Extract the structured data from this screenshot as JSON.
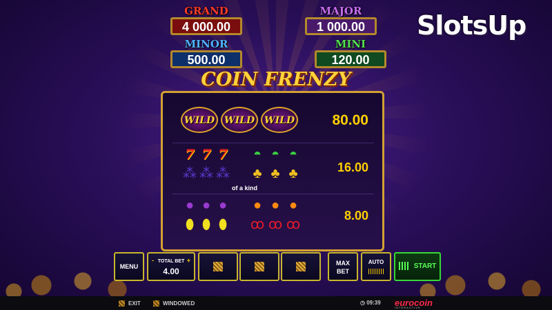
{
  "brand_logo": "SlotsUp",
  "jackpots": {
    "grand": {
      "name": "GRAND",
      "value": "4 000.00"
    },
    "major": {
      "name": "MAJOR",
      "value": "1 000.00"
    },
    "minor": {
      "name": "MINOR",
      "value": "500.00"
    },
    "mini": {
      "name": "MINI",
      "value": "120.00"
    }
  },
  "game_title": "COIN FRENZY",
  "paytable": {
    "rows": [
      {
        "symbols": [
          "WILD",
          "WILD",
          "WILD"
        ],
        "payout": "80.00"
      },
      {
        "symbols": [
          "seven",
          "watermelon",
          "grapes",
          "bell"
        ],
        "payout": "16.00"
      },
      {
        "symbols": [
          "plum",
          "orange",
          "lemon",
          "cherry"
        ],
        "payout": "8.00"
      }
    ],
    "of_a_kind_label": "of a kind"
  },
  "controls": {
    "menu_label": "MENU",
    "total_bet_label": "TOTAL BET",
    "total_bet_value": "4.00",
    "max_bet_label": "MAX BET",
    "auto_label": "AUTO",
    "start_label": "START"
  },
  "bottom_bar": {
    "exit_label": "EXIT",
    "windowed_label": "WINDOWED",
    "time": "09:39",
    "provider": "eurocoin",
    "provider_sub": "INTERACTIVE"
  },
  "colors": {
    "grand": "#ff3b2a",
    "major": "#c76cf0",
    "minor": "#4fb3ff",
    "mini": "#55e055",
    "payout": "#ffd000",
    "start_accent": "#36d936"
  }
}
